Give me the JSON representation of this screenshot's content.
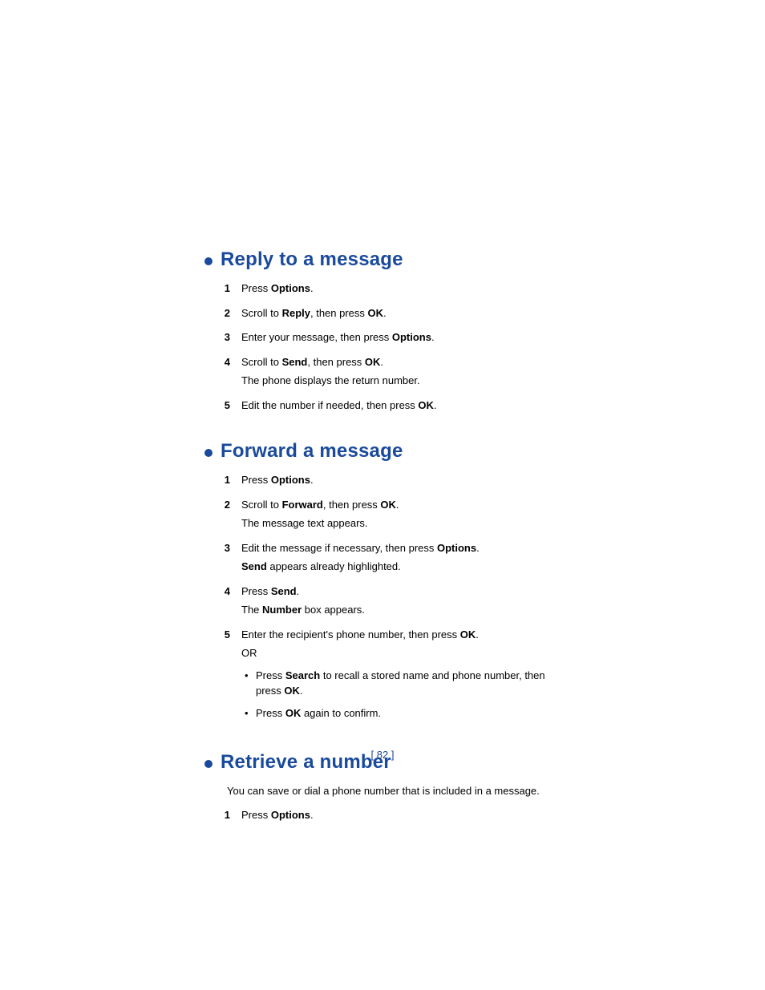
{
  "page_number": "[ 82 ]",
  "sections": [
    {
      "title": "Reply to a message",
      "intro": null,
      "steps": [
        {
          "num": "1",
          "lines": [
            [
              {
                "t": "Press "
              },
              {
                "t": "Options",
                "b": true
              },
              {
                "t": "."
              }
            ]
          ]
        },
        {
          "num": "2",
          "lines": [
            [
              {
                "t": "Scroll to "
              },
              {
                "t": "Reply",
                "b": true
              },
              {
                "t": ", then press "
              },
              {
                "t": "OK",
                "b": true
              },
              {
                "t": "."
              }
            ]
          ]
        },
        {
          "num": "3",
          "lines": [
            [
              {
                "t": "Enter your message, then press "
              },
              {
                "t": "Options",
                "b": true
              },
              {
                "t": "."
              }
            ]
          ]
        },
        {
          "num": "4",
          "lines": [
            [
              {
                "t": "Scroll to "
              },
              {
                "t": "Send",
                "b": true
              },
              {
                "t": ", then press "
              },
              {
                "t": "OK",
                "b": true
              },
              {
                "t": "."
              }
            ],
            [
              {
                "t": "The phone displays the return number."
              }
            ]
          ]
        },
        {
          "num": "5",
          "lines": [
            [
              {
                "t": "Edit the number if needed, then press "
              },
              {
                "t": "OK",
                "b": true
              },
              {
                "t": "."
              }
            ]
          ]
        }
      ]
    },
    {
      "title": "Forward a message",
      "intro": null,
      "steps": [
        {
          "num": "1",
          "lines": [
            [
              {
                "t": "Press "
              },
              {
                "t": "Options",
                "b": true
              },
              {
                "t": "."
              }
            ]
          ]
        },
        {
          "num": "2",
          "lines": [
            [
              {
                "t": "Scroll to "
              },
              {
                "t": "Forward",
                "b": true
              },
              {
                "t": ", then press "
              },
              {
                "t": "OK",
                "b": true
              },
              {
                "t": "."
              }
            ],
            [
              {
                "t": "The message text appears."
              }
            ]
          ]
        },
        {
          "num": "3",
          "lines": [
            [
              {
                "t": "Edit the message if necessary, then press "
              },
              {
                "t": "Options",
                "b": true
              },
              {
                "t": "."
              }
            ],
            [
              {
                "t": "Send",
                "b": true
              },
              {
                "t": " appears already highlighted."
              }
            ]
          ]
        },
        {
          "num": "4",
          "lines": [
            [
              {
                "t": "Press "
              },
              {
                "t": "Send",
                "b": true
              },
              {
                "t": "."
              }
            ],
            [
              {
                "t": "The "
              },
              {
                "t": "Number",
                "b": true
              },
              {
                "t": " box appears."
              }
            ]
          ]
        },
        {
          "num": "5",
          "lines": [
            [
              {
                "t": "Enter the recipient's phone number, then press "
              },
              {
                "t": "OK",
                "b": true
              },
              {
                "t": "."
              }
            ],
            [
              {
                "t": "OR"
              }
            ]
          ],
          "sub": [
            [
              {
                "t": "Press "
              },
              {
                "t": "Search",
                "b": true
              },
              {
                "t": " to recall a stored name and phone number, then press "
              },
              {
                "t": "OK",
                "b": true
              },
              {
                "t": "."
              }
            ],
            [
              {
                "t": "Press "
              },
              {
                "t": "OK",
                "b": true
              },
              {
                "t": " again to confirm."
              }
            ]
          ]
        }
      ]
    },
    {
      "title": "Retrieve a number",
      "intro": "You can save or dial a phone number that is included in a message.",
      "steps": [
        {
          "num": "1",
          "lines": [
            [
              {
                "t": "Press "
              },
              {
                "t": "Options",
                "b": true
              },
              {
                "t": "."
              }
            ]
          ]
        }
      ]
    }
  ]
}
